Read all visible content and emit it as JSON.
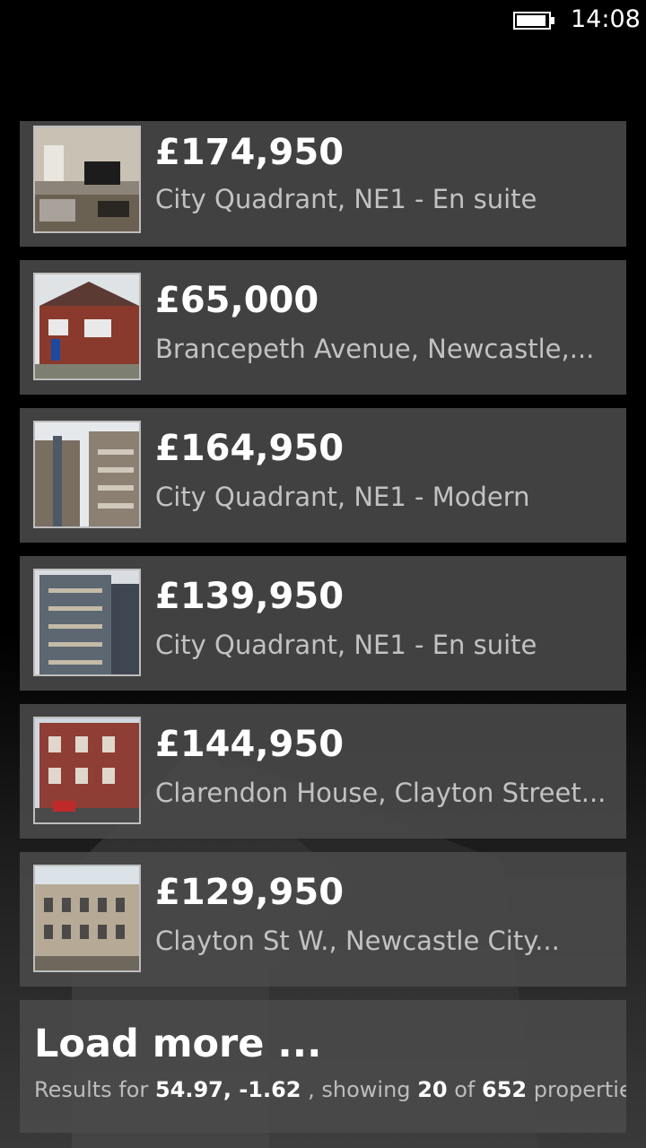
{
  "status_bar": {
    "time": "14:08",
    "battery_icon": "battery-icon"
  },
  "listings": [
    {
      "price": "£174,950",
      "address": "City Quadrant, NE1 - En suite",
      "thumbnail": "living-room-photo"
    },
    {
      "price": "£65,000",
      "address": "Brancepeth Avenue, Newcastle,...",
      "thumbnail": "semi-detached-house-photo"
    },
    {
      "price": "£164,950",
      "address": "City Quadrant, NE1 - Modern",
      "thumbnail": "apartment-block-photo"
    },
    {
      "price": "£139,950",
      "address": "City Quadrant, NE1 - En suite",
      "thumbnail": "apartment-tower-photo"
    },
    {
      "price": "£144,950",
      "address": "Clarendon House, Clayton Street...",
      "thumbnail": "red-brick-building-photo"
    },
    {
      "price": "£129,950",
      "address": "Clayton St W., Newcastle City...",
      "thumbnail": "stone-terrace-photo"
    }
  ],
  "load_more": {
    "label": "Load more ...",
    "results_prefix": "Results for",
    "coordinates": "54.97, -1.62",
    "showing_prefix": ", showing",
    "shown_count": "20",
    "of_word": "of",
    "total_count": "652",
    "suffix": "properties"
  }
}
